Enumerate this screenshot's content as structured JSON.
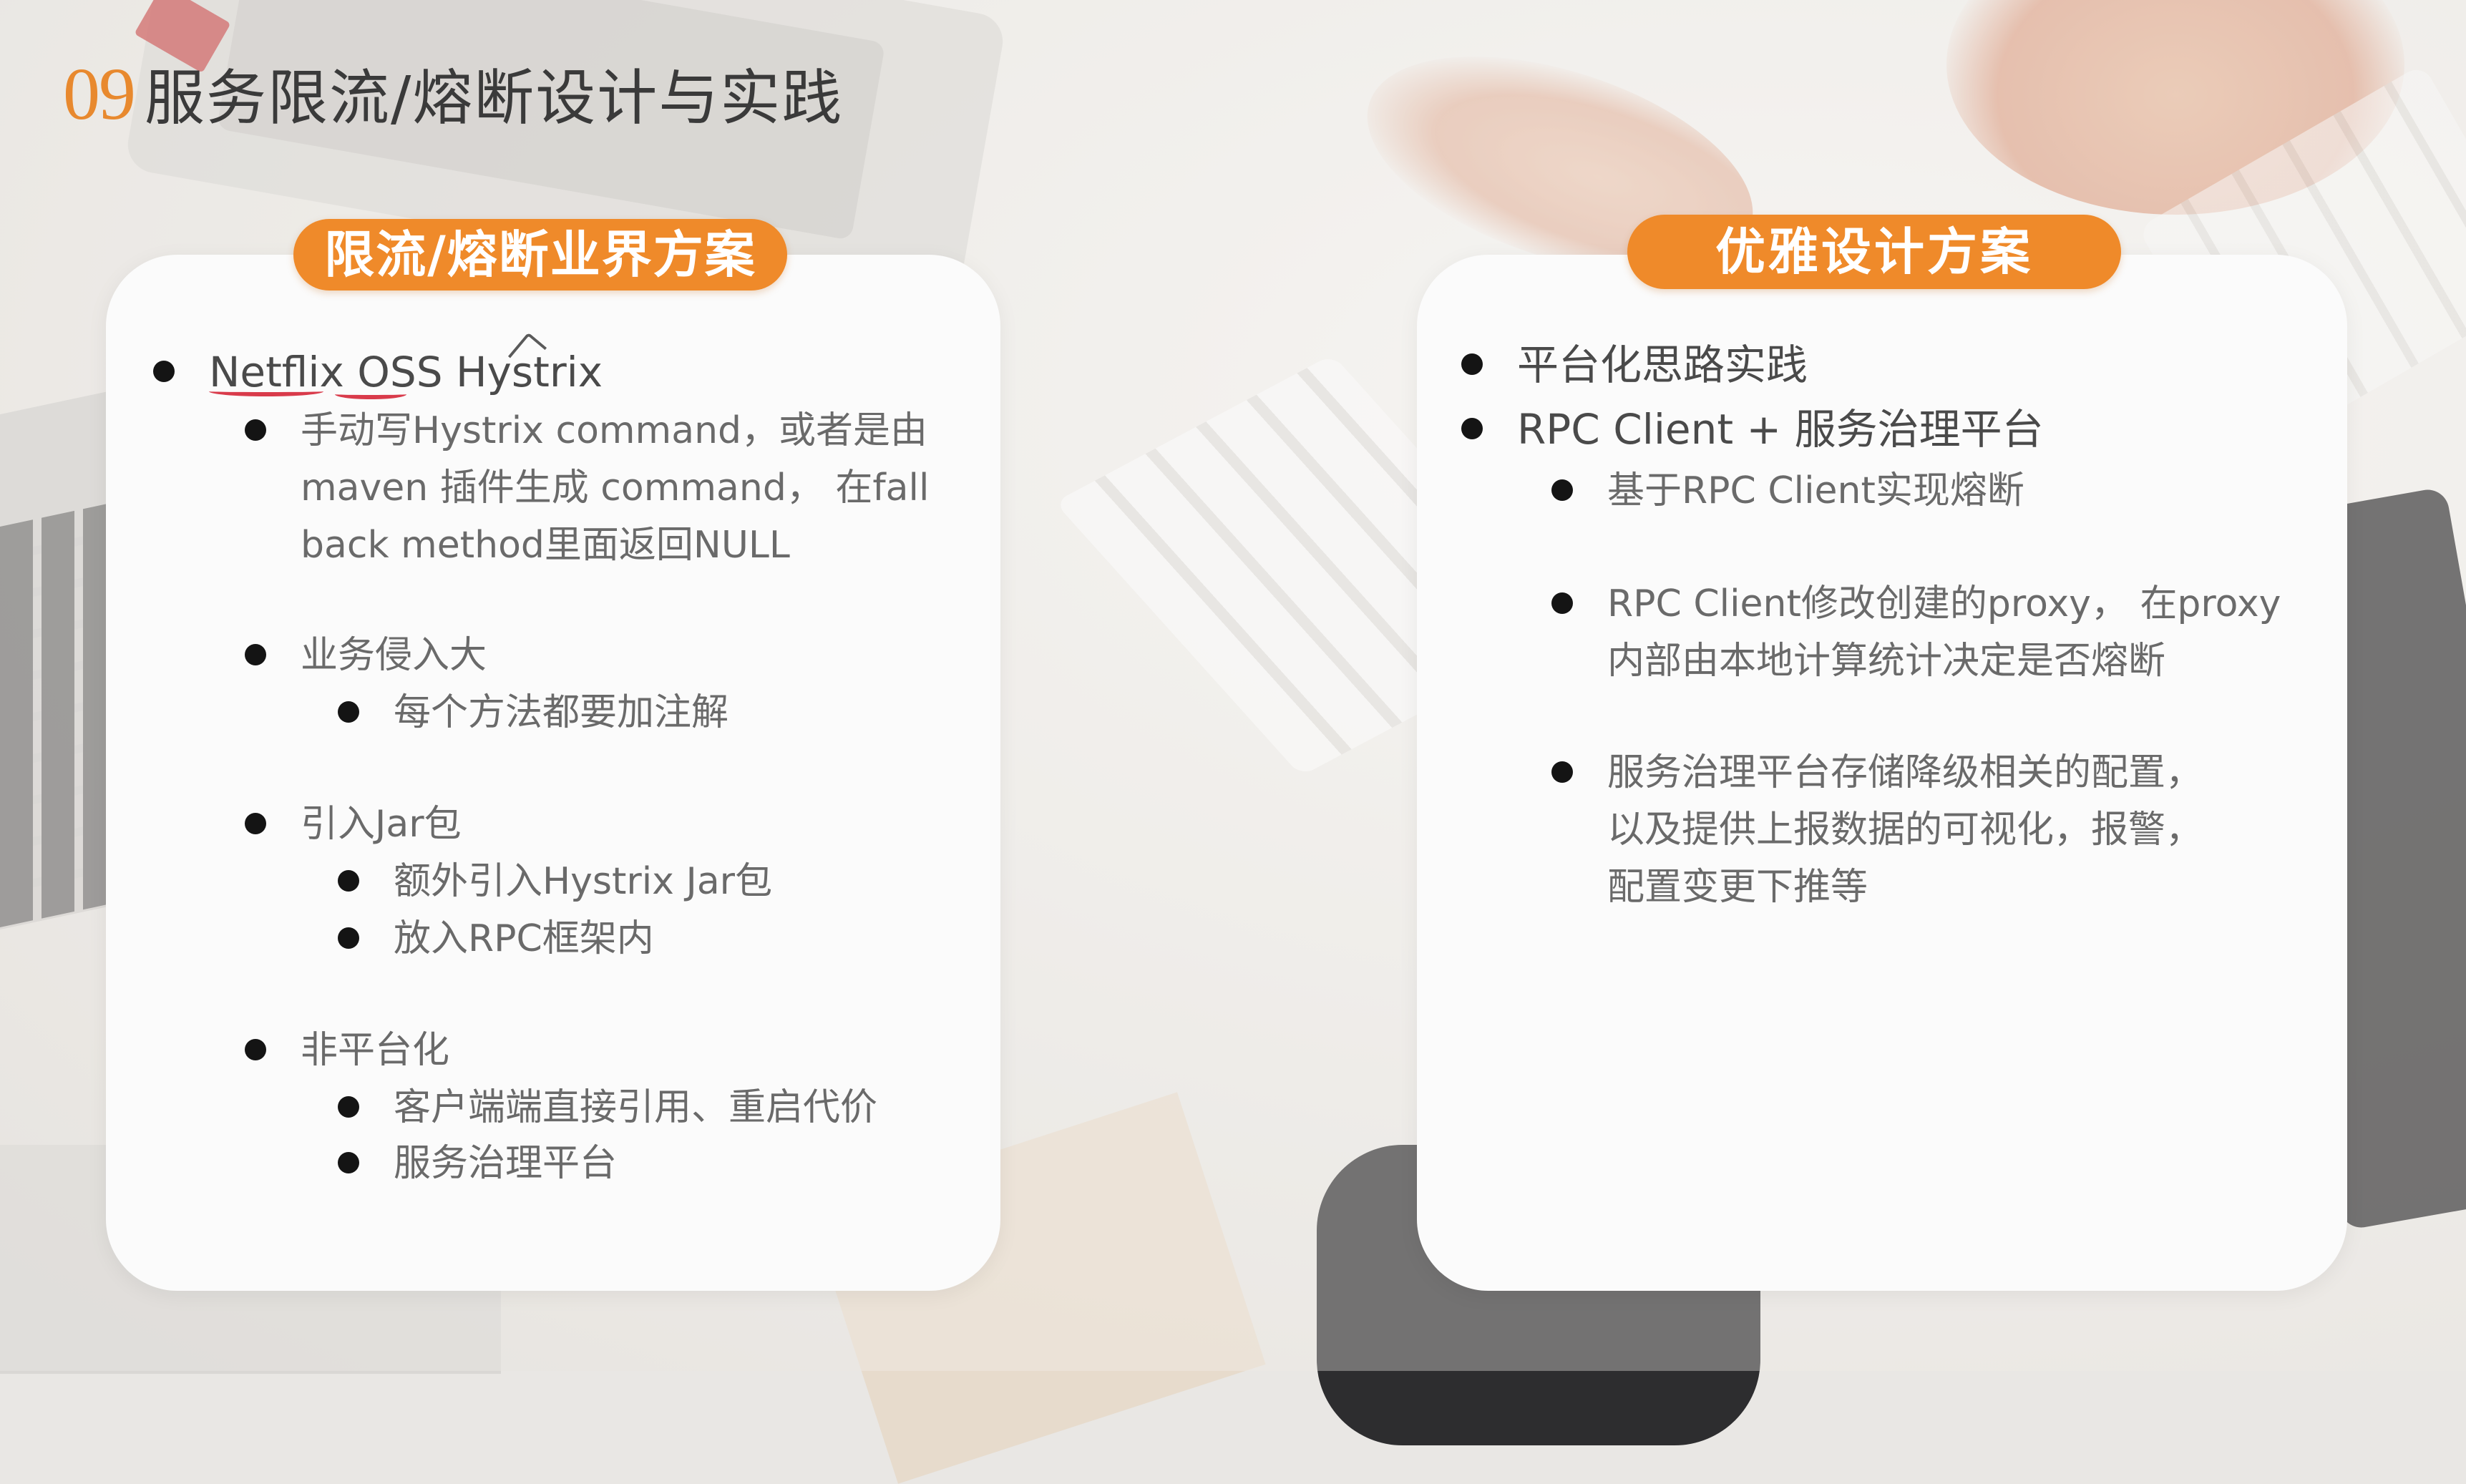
{
  "slide": {
    "number": "09",
    "title": "服务限流/熔断设计与实践"
  },
  "left_card": {
    "heading": "限流/熔断业界方案",
    "items": [
      {
        "text": "Netflix OSS Hystrix",
        "children": [
          {
            "lines": [
              "手动写Hystrix command，或者是由",
              "maven 插件生成 command， 在fall",
              "back method里面返回NULL"
            ]
          }
        ]
      },
      {
        "text": "业务侵入大",
        "children": [
          {
            "lines": [
              "每个方法都要加注解"
            ]
          }
        ]
      },
      {
        "text": "引入Jar包",
        "children": [
          {
            "lines": [
              "额外引入Hystrix Jar包"
            ]
          },
          {
            "lines": [
              "放入RPC框架内"
            ]
          }
        ]
      },
      {
        "text": "非平台化",
        "children": [
          {
            "lines": [
              "客户端端直接引用、重启代价"
            ]
          },
          {
            "lines": [
              "服务治理平台"
            ]
          }
        ]
      }
    ]
  },
  "right_card": {
    "heading": "优雅设计方案",
    "items": [
      {
        "text": "平台化思路实践"
      },
      {
        "text": "RPC Client + 服务治理平台",
        "children": [
          {
            "lines": [
              "基于RPC Client实现熔断"
            ]
          },
          {
            "lines": [
              "RPC Client修改创建的proxy， 在proxy",
              "内部由本地计算统计决定是否熔断"
            ]
          },
          {
            "lines": [
              "服务治理平台存储降级相关的配置，",
              "以及提供上报数据的可视化，报警，",
              "配置变更下推等"
            ]
          }
        ]
      }
    ]
  },
  "colors": {
    "accent": "#ef8a2a",
    "title_number": "#e8892e",
    "card_bg": "#fbfbfb",
    "underline": "#d93b4b"
  }
}
